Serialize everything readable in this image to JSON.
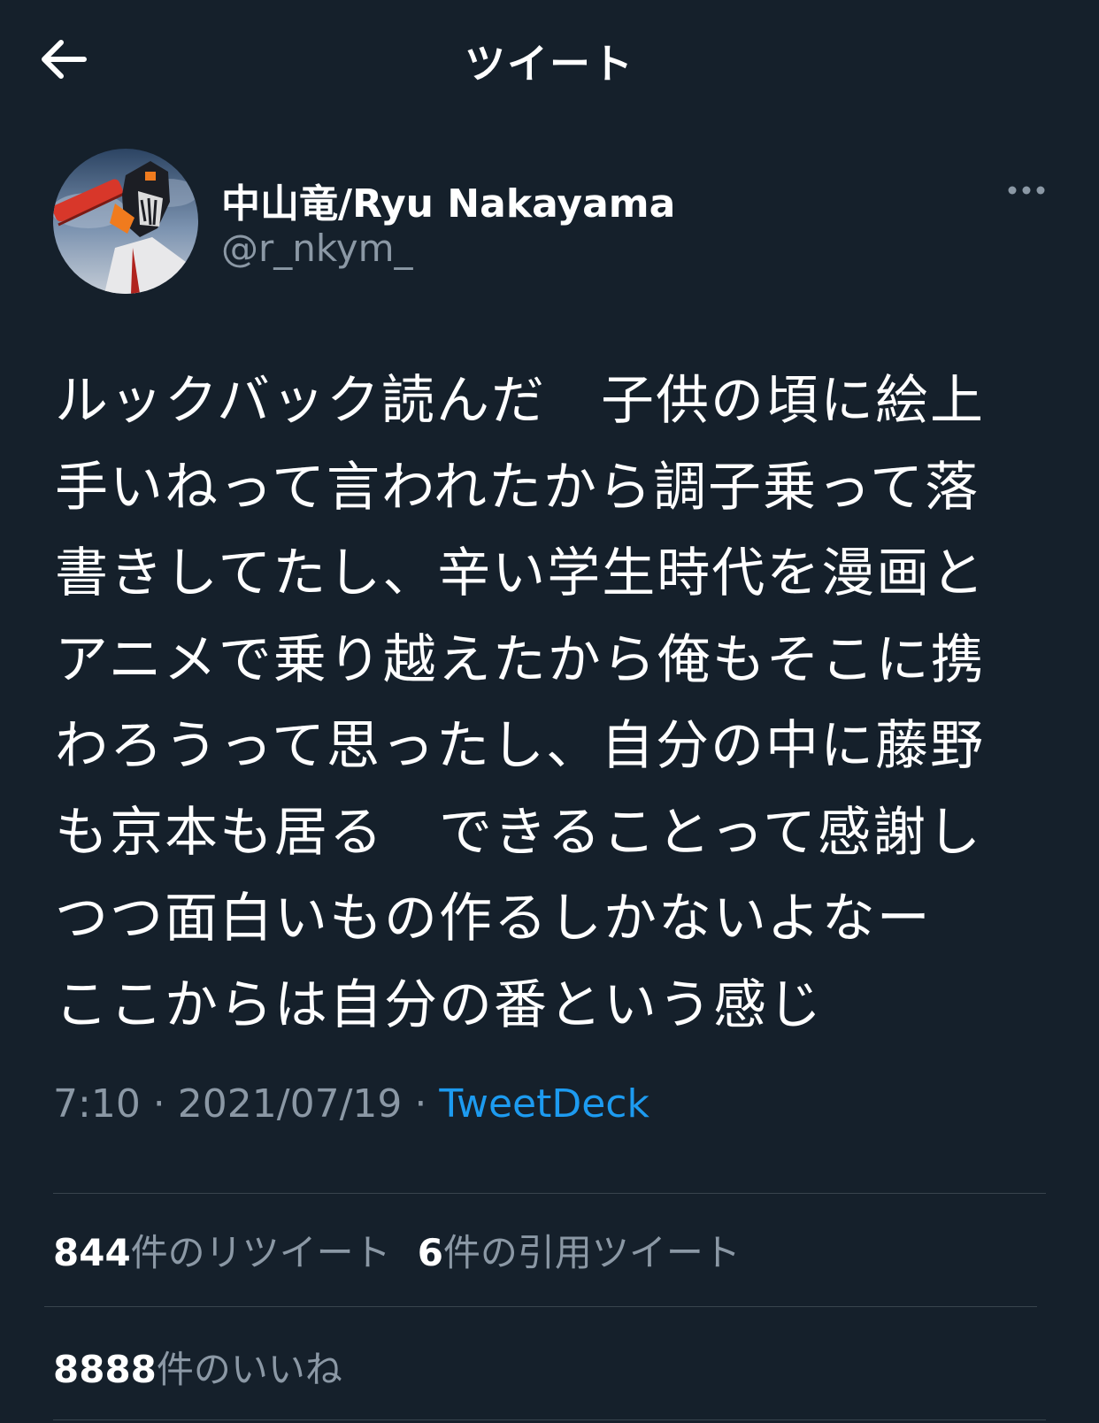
{
  "header": {
    "title": "ツイート",
    "back_icon": "arrow-left-icon"
  },
  "author": {
    "display_name": "中山竜/Ryu Nakayama",
    "handle": "@r_nkym_",
    "more_icon": "more-horizontal-icon"
  },
  "tweet": {
    "lines": [
      "ルックバック読んだ　子供の頃に絵上",
      "手いねって言われたから調子乗って落",
      "書きしてたし、辛い学生時代を漫画と",
      "アニメで乗り越えたから俺もそこに携",
      "わろうって思ったし、自分の中に藤野",
      "も京本も居る　できることって感謝し",
      "つつ面白いもの作るしかないよなー",
      "ここからは自分の番という感じ"
    ]
  },
  "meta": {
    "time": "7:10",
    "separator": " · ",
    "date": "2021/07/19",
    "source": "TweetDeck"
  },
  "stats": {
    "retweets_count": "844",
    "retweets_label": "件のリツイート",
    "quotes_count": "6",
    "quotes_label": "件の引用ツイート",
    "likes_count": "8888",
    "likes_label": "件のいいね"
  },
  "colors": {
    "background": "#15202b",
    "text_primary": "#ffffff",
    "text_secondary": "#8b98a5",
    "link": "#1d9bf0",
    "divider": "#38444d"
  }
}
